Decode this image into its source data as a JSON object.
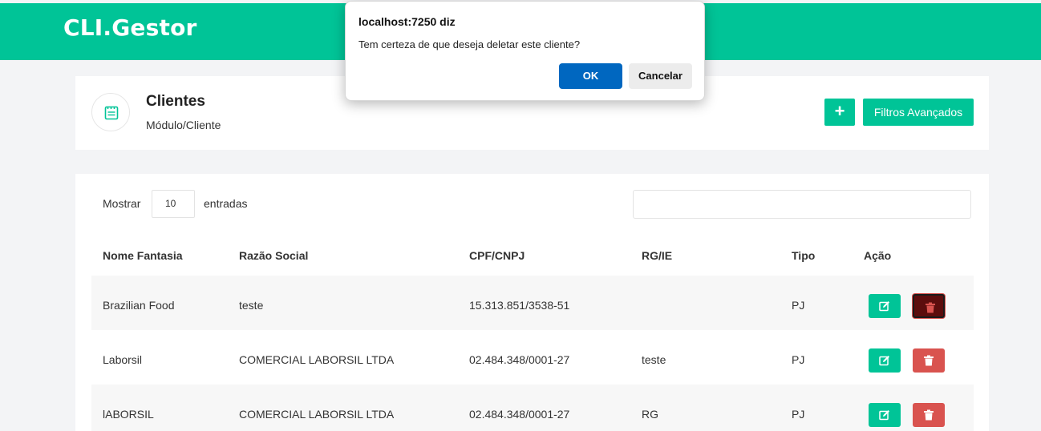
{
  "app": {
    "brand": "CLI.Gestor"
  },
  "header": {
    "title": "Clientes",
    "breadcrumb": "Módulo/Cliente",
    "add_label": "+",
    "filters_label": "Filtros Avançados"
  },
  "table_controls": {
    "show_label": "Mostrar",
    "page_size": "10",
    "entries_label": "entradas",
    "search_value": ""
  },
  "columns": [
    "Nome Fantasia",
    "Razão Social",
    "CPF/CNPJ",
    "RG/IE",
    "Tipo",
    "Ação"
  ],
  "rows": [
    {
      "nome": "Brazilian Food",
      "razao": "teste",
      "doc": "15.313.851/3538-51",
      "rg": "",
      "tipo": "PJ"
    },
    {
      "nome": "Laborsil",
      "razao": "COMERCIAL LABORSIL LTDA",
      "doc": "02.484.348/0001-27",
      "rg": "teste",
      "tipo": "PJ"
    },
    {
      "nome": "lABORSIL",
      "razao": "COMERCIAL LABORSIL LTDA",
      "doc": "02.484.348/0001-27",
      "rg": "RG",
      "tipo": "PJ"
    }
  ],
  "dialog": {
    "title": "localhost:7250 diz",
    "message": "Tem certeza de que deseja deletar este cliente?",
    "ok_label": "OK",
    "cancel_label": "Cancelar"
  },
  "colors": {
    "brand": "#00c497",
    "danger": "#d9534f",
    "dialog_primary": "#0067c0"
  }
}
